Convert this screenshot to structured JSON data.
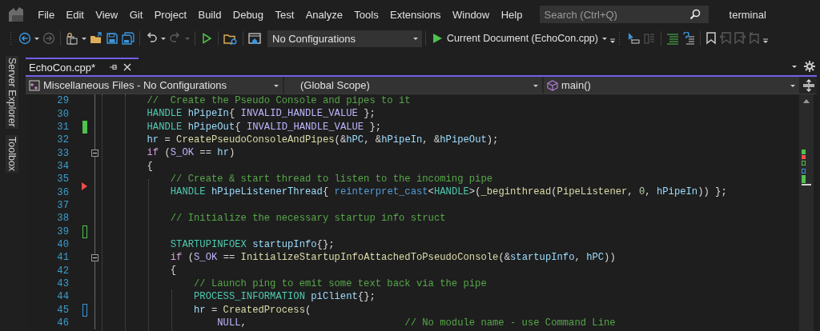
{
  "menu_bar": {
    "items": [
      "File",
      "Edit",
      "View",
      "Git",
      "Project",
      "Build",
      "Debug",
      "Test",
      "Analyze",
      "Tools",
      "Extensions",
      "Window",
      "Help"
    ]
  },
  "search": {
    "placeholder": "Search (Ctrl+Q)"
  },
  "solution_name": "terminal",
  "toolbar": [
    {
      "kind": "grip"
    },
    {
      "kind": "back",
      "disabled": false
    },
    {
      "kind": "caret",
      "disabled": false
    },
    {
      "kind": "forward",
      "disabled": true
    },
    {
      "kind": "separator"
    },
    {
      "kind": "new_project",
      "disabled": false
    },
    {
      "kind": "caret",
      "disabled": false
    },
    {
      "kind": "open",
      "disabled": false
    },
    {
      "kind": "save",
      "disabled": false
    },
    {
      "kind": "save_all",
      "disabled": false
    },
    {
      "kind": "separator"
    },
    {
      "kind": "undo",
      "disabled": false
    },
    {
      "kind": "caret",
      "disabled": false
    },
    {
      "kind": "redo",
      "disabled": true
    },
    {
      "kind": "caret",
      "disabled": true
    },
    {
      "kind": "separator"
    },
    {
      "kind": "run",
      "disabled": false
    },
    {
      "kind": "separator"
    },
    {
      "kind": "find_files",
      "disabled": false
    },
    {
      "kind": "separator"
    },
    {
      "kind": "window",
      "disabled": false
    },
    {
      "kind": "dropdown",
      "value": "No Configurations"
    },
    {
      "kind": "separator"
    },
    {
      "kind": "start",
      "label": "Current Document (EchoCon.cpp)"
    },
    {
      "kind": "caret",
      "disabled": false
    },
    {
      "kind": "overflow",
      "disabled": false
    },
    {
      "kind": "grip"
    },
    {
      "kind": "cursor",
      "disabled": false
    },
    {
      "kind": "panels",
      "disabled": true
    },
    {
      "kind": "separator"
    },
    {
      "kind": "comment",
      "disabled": false
    },
    {
      "kind": "uncomment",
      "disabled": false
    },
    {
      "kind": "separator"
    },
    {
      "kind": "bookmark",
      "disabled": false
    },
    {
      "kind": "bookmark_prev",
      "disabled": true
    },
    {
      "kind": "bookmark_next",
      "disabled": true
    },
    {
      "kind": "bookmark_clear",
      "disabled": true
    },
    {
      "kind": "overflow",
      "disabled": false
    }
  ],
  "side_tabs": [
    "Server Explorer",
    "Toolbox"
  ],
  "document_tabs": [
    {
      "label": "EchoCon.cpp*",
      "selected": true
    }
  ],
  "navigation_bar": {
    "project": "Miscellaneous Files - No Configurations",
    "scope": "(Global Scope)",
    "member": "main()"
  },
  "editor": {
    "lines": [
      {
        "number": "29",
        "tokens": [
          {
            "kind": "comment",
            "text": "        //  Create the Pseudo Console and pipes to it"
          }
        ]
      },
      {
        "number": "30",
        "tokens": [
          {
            "kind": "type",
            "text": "        HANDLE"
          },
          {
            "kind": "variable",
            "text": " hPipeIn"
          },
          {
            "kind": "plain",
            "text": "{ "
          },
          {
            "kind": "macro",
            "text": "INVALID_HANDLE_VALUE"
          },
          {
            "kind": "plain",
            "text": " };"
          }
        ]
      },
      {
        "number": "31",
        "marker": {
          "kind": "bar",
          "color": "#4fc14f"
        },
        "tokens": [
          {
            "kind": "type",
            "text": "        HANDLE"
          },
          {
            "kind": "variable",
            "text": " hPipeOut"
          },
          {
            "kind": "plain",
            "text": "{ "
          },
          {
            "kind": "macro",
            "text": "INVALID_HANDLE_VALUE"
          },
          {
            "kind": "plain",
            "text": " };"
          }
        ]
      },
      {
        "number": "32",
        "tokens": [
          {
            "kind": "variable",
            "text": "        hr"
          },
          {
            "kind": "plain",
            "text": " = "
          },
          {
            "kind": "function",
            "text": "CreatePseudoConsoleAndPipes"
          },
          {
            "kind": "plain",
            "text": "(&"
          },
          {
            "kind": "variable",
            "text": "hPC"
          },
          {
            "kind": "plain",
            "text": ", &"
          },
          {
            "kind": "variable",
            "text": "hPipeIn"
          },
          {
            "kind": "plain",
            "text": ", &"
          },
          {
            "kind": "variable",
            "text": "hPipeOut"
          },
          {
            "kind": "plain",
            "text": ");"
          }
        ]
      },
      {
        "number": "33",
        "expanded": true,
        "tokens": [
          {
            "kind": "keyword",
            "text": "        if"
          },
          {
            "kind": "plain",
            "text": " ("
          },
          {
            "kind": "macro",
            "text": "S_OK"
          },
          {
            "kind": "plain",
            "text": " == "
          },
          {
            "kind": "variable",
            "text": "hr"
          },
          {
            "kind": "plain",
            "text": ")"
          }
        ]
      },
      {
        "number": "34",
        "tokens": [
          {
            "kind": "plain",
            "text": "        {"
          }
        ]
      },
      {
        "number": "35",
        "tokens": [
          {
            "kind": "comment",
            "text": "            // Create & start thread to listen to the incoming pipe"
          }
        ]
      },
      {
        "number": "36",
        "marker": {
          "kind": "triangle",
          "color": "#f14c4c"
        },
        "tokens": [
          {
            "kind": "type",
            "text": "            HANDLE"
          },
          {
            "kind": "variable",
            "text": " hPipeListenerThread"
          },
          {
            "kind": "plain",
            "text": "{ "
          },
          {
            "kind": "cast",
            "text": "reinterpret_cast"
          },
          {
            "kind": "plain",
            "text": "<"
          },
          {
            "kind": "type",
            "text": "HANDLE"
          },
          {
            "kind": "plain",
            "text": ">("
          },
          {
            "kind": "function",
            "text": "_beginthread"
          },
          {
            "kind": "plain",
            "text": "("
          },
          {
            "kind": "function",
            "text": "PipeListener"
          },
          {
            "kind": "plain",
            "text": ", "
          },
          {
            "kind": "number",
            "text": "0"
          },
          {
            "kind": "plain",
            "text": ", "
          },
          {
            "kind": "variable",
            "text": "hPipeIn"
          },
          {
            "kind": "plain",
            "text": ")) };"
          }
        ]
      },
      {
        "number": "37"
      },
      {
        "number": "38",
        "tokens": [
          {
            "kind": "comment",
            "text": "            // Initialize the necessary startup info struct"
          }
        ]
      },
      {
        "number": "39",
        "marker": {
          "kind": "outline",
          "color": "#4fc14f"
        }
      },
      {
        "number": "40",
        "tokens": [
          {
            "kind": "type",
            "text": "            STARTUPINFOEX"
          },
          {
            "kind": "variable",
            "text": " startupInfo"
          },
          {
            "kind": "plain",
            "text": "{};"
          }
        ]
      },
      {
        "number": "41",
        "expanded": true,
        "tokens": [
          {
            "kind": "keyword",
            "text": "            if"
          },
          {
            "kind": "plain",
            "text": " ("
          },
          {
            "kind": "macro",
            "text": "S_OK"
          },
          {
            "kind": "plain",
            "text": " == "
          },
          {
            "kind": "function",
            "text": "InitializeStartupInfoAttachedToPseudoConsole"
          },
          {
            "kind": "plain",
            "text": "(&"
          },
          {
            "kind": "variable",
            "text": "startupInfo"
          },
          {
            "kind": "plain",
            "text": ", "
          },
          {
            "kind": "variable",
            "text": "hPC"
          },
          {
            "kind": "plain",
            "text": "))"
          }
        ]
      },
      {
        "number": "42",
        "tokens": [
          {
            "kind": "plain",
            "text": "            {"
          }
        ]
      },
      {
        "number": "43",
        "tokens": [
          {
            "kind": "comment",
            "text": "                // Launch ping to emit some text back via the pipe"
          }
        ]
      },
      {
        "number": "44",
        "tokens": [
          {
            "kind": "type",
            "text": "                PROCESS_INFORMATION"
          },
          {
            "kind": "variable",
            "text": " piClient"
          },
          {
            "kind": "plain",
            "text": "{};"
          }
        ]
      },
      {
        "number": "45",
        "marker": {
          "kind": "outline",
          "color": "#3a96dd"
        },
        "tokens": [
          {
            "kind": "variable",
            "text": "                hr"
          },
          {
            "kind": "plain",
            "text": " = "
          },
          {
            "kind": "function",
            "text": "CreatedProcess"
          },
          {
            "kind": "plain",
            "text": "("
          }
        ]
      },
      {
        "number": "46",
        "tokens": [
          {
            "kind": "macro",
            "text": "                    NULL"
          },
          {
            "kind": "plain",
            "text": ",                           "
          },
          {
            "kind": "comment",
            "text": "// No module name - use Command Line"
          }
        ]
      }
    ]
  }
}
